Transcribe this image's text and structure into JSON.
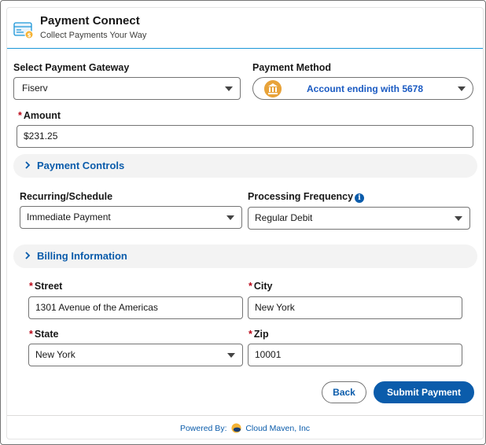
{
  "app": {
    "title": "Payment Connect",
    "subtitle": "Collect Payments Your Way",
    "icon": "credit-card-icon"
  },
  "gateway": {
    "label": "Select Payment Gateway",
    "value": "Fiserv"
  },
  "payment_method": {
    "label": "Payment Method",
    "value": "Account ending with 5678",
    "icon": "bank-icon"
  },
  "amount": {
    "required_mark": "*",
    "label": "Amount",
    "value": "$231.25"
  },
  "payment_controls": {
    "title": "Payment Controls",
    "icon": "chevron-right-icon"
  },
  "recurring": {
    "label": "Recurring/Schedule",
    "value": "Immediate Payment"
  },
  "frequency": {
    "label": "Processing Frequency",
    "value": "Regular Debit",
    "info_icon": "info-icon"
  },
  "billing": {
    "title": "Billing Information",
    "street": {
      "required_mark": "*",
      "label": "Street",
      "value": "1301 Avenue of the Americas"
    },
    "city": {
      "required_mark": "*",
      "label": "City",
      "value": "New York"
    },
    "state": {
      "required_mark": "*",
      "label": "State",
      "value": "New York"
    },
    "zip": {
      "required_mark": "*",
      "label": "Zip",
      "value": "10001"
    }
  },
  "buttons": {
    "back": "Back",
    "submit": "Submit Payment"
  },
  "footer": {
    "powered_by": "Powered By:",
    "company": "Cloud Maven, Inc"
  },
  "colors": {
    "brand_blue": "#0b5cab",
    "accent_line": "#1b96d8",
    "required": "#ba0517",
    "bank_icon": "#e8a33a"
  }
}
